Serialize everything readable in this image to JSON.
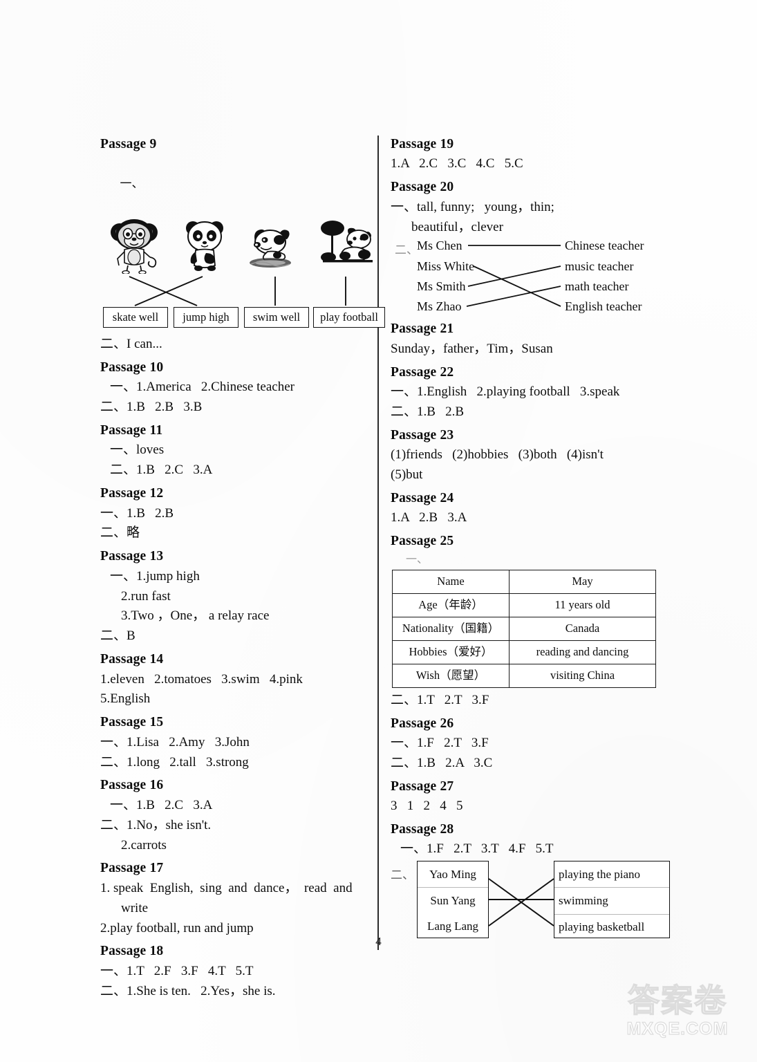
{
  "page": {
    "number": "4",
    "watermark_cn": "答案卷",
    "watermark_url": "MXQE.COM"
  },
  "markers": {
    "one": "一、",
    "two": "二、"
  },
  "left_column": [
    {
      "heading": "Passage 9",
      "marker": "一、",
      "figure": {
        "animals": [
          {
            "name": "monkey-illustration",
            "label": "monkey"
          },
          {
            "name": "panda-illustration",
            "label": "panda"
          },
          {
            "name": "swimming-dog-illustration",
            "label": "dog swimming"
          },
          {
            "name": "dog-with-tree-illustration",
            "label": "dog by tree"
          }
        ],
        "options": [
          "skate well",
          "jump high",
          "swim well",
          "play football"
        ],
        "connections": [
          {
            "from": "monkey",
            "to": "jump high"
          },
          {
            "from": "panda",
            "to": "skate well"
          },
          {
            "from": "swimming dog",
            "to": "swim well"
          },
          {
            "from": "dog by tree",
            "to": "play football"
          }
        ]
      },
      "after_figure": "二、I can..."
    },
    {
      "heading": "Passage 10",
      "lines": [
        "一、1.America   2.Chinese teacher",
        "二、1.B   2.B   3.B"
      ]
    },
    {
      "heading": "Passage 11",
      "lines": [
        "一、loves",
        "二、1.B   2.C   3.A"
      ]
    },
    {
      "heading": "Passage 12",
      "lines": [
        "一、1.B   2.B",
        "二、略"
      ]
    },
    {
      "heading": "Passage 13",
      "lines": [
        "一、1.jump high",
        "2.run fast",
        "3.Two ，One， a relay race",
        "二、B"
      ]
    },
    {
      "heading": "Passage 14",
      "lines": [
        "1.eleven   2.tomatoes   3.swim   4.pink",
        "5.English"
      ]
    },
    {
      "heading": "Passage 15",
      "lines": [
        "一、1.Lisa   2.Amy   3.John",
        "二、1.long   2.tall   3.strong"
      ]
    },
    {
      "heading": "Passage 16",
      "lines": [
        "一、1.B   2.C   3.A",
        "二、1.No，she isn't.",
        "2.carrots"
      ]
    },
    {
      "heading": "Passage 17",
      "lines": [
        "1. speak  English,  sing  and  dance，  read  and",
        "write",
        "2.play football, run and jump"
      ]
    },
    {
      "heading": "Passage 18",
      "lines": [
        "一、1.T   2.F   3.F   4.T   5.T",
        "二、1.She is ten.   2.Yes，she is."
      ]
    }
  ],
  "right_column": [
    {
      "heading": "Passage 19",
      "lines": [
        "1.A   2.C   3.C   4.C   5.C"
      ]
    },
    {
      "heading": "Passage 20",
      "lines": [
        "一、tall, funny;   young，thin;",
        "beautiful，clever"
      ],
      "match": {
        "marker": "二、",
        "left_items": [
          "Ms Chen",
          "Miss White",
          "Ms Smith",
          "Ms Zhao"
        ],
        "right_items": [
          "Chinese teacher",
          "music teacher",
          "math teacher",
          "English teacher"
        ],
        "pairs": [
          {
            "from": "Ms Chen",
            "to": "Chinese teacher"
          },
          {
            "from": "Miss White",
            "to": "English teacher"
          },
          {
            "from": "Ms Smith",
            "to": "music teacher"
          },
          {
            "from": "Ms Zhao",
            "to": "math teacher"
          }
        ]
      }
    },
    {
      "heading": "Passage 21",
      "lines": [
        "Sunday，father，Tim，Susan"
      ]
    },
    {
      "heading": "Passage 22",
      "lines": [
        "一、1.English   2.playing football   3.speak",
        "二、1.B   2.B"
      ]
    },
    {
      "heading": "Passage 23",
      "lines": [
        "(1)friends   (2)hobbies   (3)both   (4)isn't",
        "(5)but"
      ]
    },
    {
      "heading": "Passage 24",
      "lines": [
        "1.A   2.B   3.A"
      ]
    },
    {
      "heading": "Passage 25",
      "table_marker": "一、",
      "table": {
        "rows": [
          {
            "key": "Name",
            "value": "May"
          },
          {
            "key": "Age（年龄）",
            "value": "11 years old"
          },
          {
            "key": "Nationality（国籍）",
            "value": "Canada"
          },
          {
            "key": "Hobbies（爱好）",
            "value": "reading and dancing"
          },
          {
            "key": "Wish（愿望）",
            "value": "visiting China"
          }
        ]
      },
      "after_table": "二、1.T   2.T   3.F"
    },
    {
      "heading": "Passage 26",
      "lines": [
        "一、1.F   2.T   3.F",
        "二、1.B   2.A   3.C"
      ]
    },
    {
      "heading": "Passage 27",
      "lines": [
        "3   1   2   4   5"
      ]
    },
    {
      "heading": "Passage 28",
      "lines": [
        "一、1.F   2.T   3.T   4.F   5.T"
      ],
      "match": {
        "marker": "二、",
        "left_items": [
          "Yao Ming",
          "Sun Yang",
          "Lang Lang"
        ],
        "right_items": [
          "playing the piano",
          "swimming",
          "playing basketball"
        ],
        "pairs": [
          {
            "from": "Yao Ming",
            "to": "playing basketball"
          },
          {
            "from": "Sun Yang",
            "to": "swimming"
          },
          {
            "from": "Lang Lang",
            "to": "playing the piano"
          }
        ]
      }
    }
  ]
}
